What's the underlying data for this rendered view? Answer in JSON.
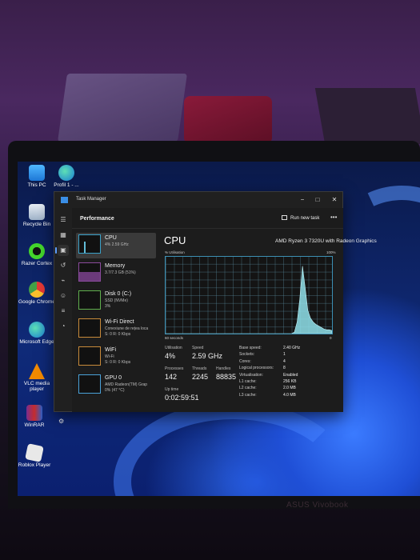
{
  "background": {
    "brand_text": "ASUS Vivobook"
  },
  "desktop_icons": [
    {
      "label": "This PC",
      "icon": "computer-icon"
    },
    {
      "label": "Profil 1 - ...",
      "icon": "edge-icon"
    },
    {
      "label": "Recycle Bin",
      "icon": "recycle-bin-icon"
    },
    {
      "label": "Razer Cortex",
      "icon": "razer-icon"
    },
    {
      "label": "Google Chrome",
      "icon": "chrome-icon"
    },
    {
      "label": "Microsoft Edge",
      "icon": "edge-icon"
    },
    {
      "label": "VLC media player",
      "icon": "vlc-icon"
    },
    {
      "label": "WinRAR",
      "icon": "winrar-icon"
    },
    {
      "label": "Roblox Player",
      "icon": "roblox-icon"
    }
  ],
  "window": {
    "title": "Task Manager",
    "controls": {
      "minimize": "−",
      "maximize": "□",
      "close": "✕"
    }
  },
  "header": {
    "title": "Performance",
    "run_new_task": "Run new task",
    "more": "•••"
  },
  "resources": [
    {
      "name": "CPU",
      "sub": "4% 2.59 GHz",
      "sub2": ""
    },
    {
      "name": "Memory",
      "sub": "3.7/7.3 GB (51%)",
      "sub2": ""
    },
    {
      "name": "Disk 0 (C:)",
      "sub": "SSD (NVMe)",
      "sub2": "3%"
    },
    {
      "name": "Wi-Fi Direct",
      "sub": "Conexiune de rețea loca",
      "sub2": "S: 0 R: 0 Kbps"
    },
    {
      "name": "WiFi",
      "sub": "Wi-Fi",
      "sub2": "S: 0 R: 0 Kbps"
    },
    {
      "name": "GPU 0",
      "sub": "AMD Radeon(TM) Grap",
      "sub2": "0% (47 °C)"
    }
  ],
  "cpu_panel": {
    "title": "CPU",
    "model": "AMD Ryzen 3 7320U with Radeon Graphics",
    "utilisation_label": "% Utilisation",
    "max_label": "100%",
    "axis_left": "60 seconds",
    "axis_right": "0",
    "stats": {
      "utilisation_label": "Utilisation",
      "utilisation": "4%",
      "speed_label": "Speed",
      "speed": "2.59 GHz",
      "processes_label": "Processes",
      "processes": "142",
      "threads_label": "Threads",
      "threads": "2245",
      "handles_label": "Handles",
      "handles": "88835",
      "uptime_label": "Up time",
      "uptime": "0:02:59:51"
    },
    "details": [
      {
        "k": "Base speed:",
        "v": "2.40 GHz"
      },
      {
        "k": "Sockets:",
        "v": "1"
      },
      {
        "k": "Cores:",
        "v": "4"
      },
      {
        "k": "Logical processors:",
        "v": "8"
      },
      {
        "k": "Virtualisation:",
        "v": "Enabled"
      },
      {
        "k": "L1 cache:",
        "v": "256 KB"
      },
      {
        "k": "L2 cache:",
        "v": "2.0 MB"
      },
      {
        "k": "L3 cache:",
        "v": "4.0 MB"
      }
    ],
    "graph_color": "#8fe0ea",
    "graph_values": [
      0,
      0,
      0,
      0,
      0,
      0,
      0,
      0,
      0,
      0,
      0,
      0,
      0,
      0,
      0,
      0,
      0,
      0,
      0,
      0,
      0,
      0,
      0,
      0,
      0,
      0,
      0,
      0,
      0,
      0,
      0,
      0,
      0,
      0,
      0,
      0,
      0,
      0,
      0,
      0,
      0,
      0,
      0,
      0,
      0,
      0,
      0,
      0,
      2,
      15,
      45,
      88,
      60,
      30,
      20,
      15,
      12,
      10,
      8,
      6,
      5,
      5,
      4
    ]
  }
}
